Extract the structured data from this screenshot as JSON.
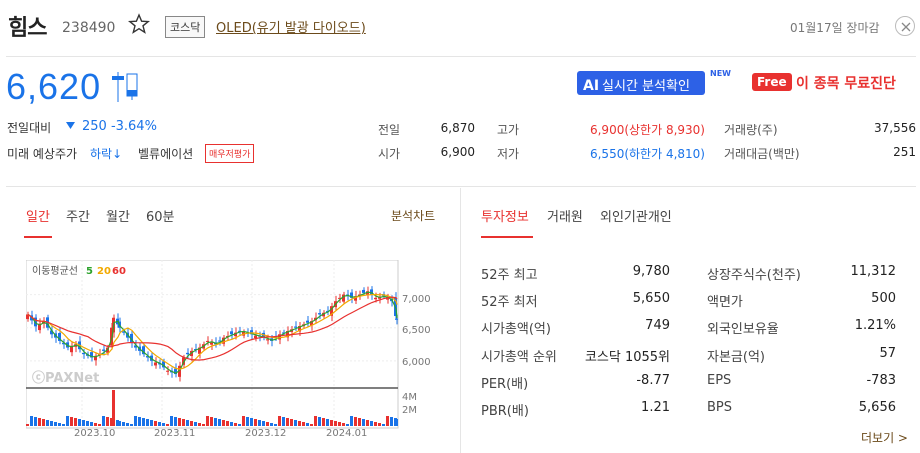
{
  "header": {
    "stock_name": "힘스",
    "stock_code": "238490",
    "market": "코스닥",
    "sector": "OLED(유기 발광 다이오드)",
    "market_time": "01월17일 장마감"
  },
  "price": {
    "current": "6,620",
    "change_label": "전일대비",
    "change": "250 -3.64%",
    "prediction_label": "미래 예상주가",
    "prediction": "하락↓",
    "valuation_label": "벨류에이션",
    "evaluation_button": "매우저평가",
    "ai_button_bold": "AI",
    "ai_button_text": "실시간 분석확인",
    "new_badge": "NEW",
    "free_badge": "Free",
    "diagnosis_link": "이 종목 무료진단"
  },
  "quote": {
    "prev_label": "전일",
    "prev": "6,870",
    "open_label": "시가",
    "open": "6,900",
    "high_label": "고가",
    "high": "6,900(상한가 8,930)",
    "low_label": "저가",
    "low": "6,550(하한가 4,810)",
    "volume_label": "거래량(주)",
    "volume": "37,556",
    "amount_label": "거래대금(백만)",
    "amount": "251"
  },
  "chart_tabs": [
    "일간",
    "주간",
    "월간",
    "60분"
  ],
  "analysis_chart_link": "분석차트",
  "info_tabs": [
    "투자정보",
    "거래원",
    "외인기관개인"
  ],
  "chart": {
    "legend_title": "이동평균선",
    "ma5": "5",
    "ma20": "20",
    "ma60": "60",
    "watermark": "ⓒPAXNet",
    "y_labels": [
      "7,000",
      "6,500",
      "6,000"
    ],
    "vol_labels": [
      "4M",
      "2M"
    ],
    "x_labels": [
      "2023.10",
      "2023.11",
      "2023.12",
      "2024.01"
    ],
    "colors": {
      "up": "#e8312f",
      "down": "#1a73e8",
      "ma5": "#2ea32e",
      "ma20": "#f2a900",
      "ma60": "#e8312f"
    }
  },
  "chart_data": {
    "type": "candlestick",
    "x": [
      "2023.10",
      "2023.11",
      "2023.12",
      "2024.01"
    ],
    "ylim": [
      5650,
      7250
    ],
    "y_ticks": [
      6000,
      6500,
      7000
    ],
    "volume_ticks": [
      "2M",
      "4M"
    ],
    "series": [
      {
        "name": "5"
      },
      {
        "name": "20"
      },
      {
        "name": "60"
      }
    ]
  },
  "investment": {
    "left": [
      {
        "label": "52주 최고",
        "value": "9,780"
      },
      {
        "label": "52주 최저",
        "value": "5,650"
      },
      {
        "label": "시가총액(억)",
        "value": "749"
      },
      {
        "label": "시가총액 순위",
        "value": "코스닥 1055위"
      },
      {
        "label": "PER(배)",
        "value": "-8.77"
      },
      {
        "label": "PBR(배)",
        "value": "1.21"
      }
    ],
    "right": [
      {
        "label": "상장주식수(천주)",
        "value": "11,312"
      },
      {
        "label": "액면가",
        "value": "500"
      },
      {
        "label": "외국인보유율",
        "value": "1.21%"
      },
      {
        "label": "자본금(억)",
        "value": "57"
      },
      {
        "label": "EPS",
        "value": "-783"
      },
      {
        "label": "BPS",
        "value": "5,656"
      }
    ],
    "more_link": "더보기 >"
  }
}
